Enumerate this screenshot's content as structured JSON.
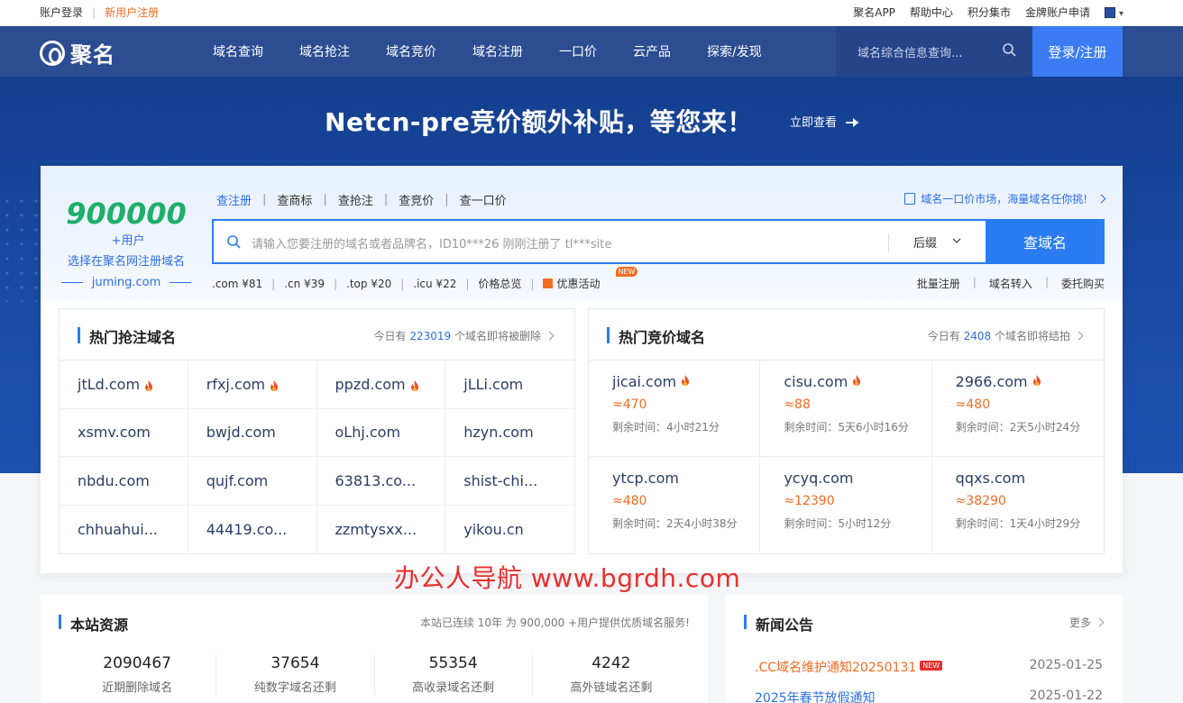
{
  "topbar": {
    "login": "账户登录",
    "register": "新用户注册",
    "links": [
      "聚名APP",
      "帮助中心",
      "积分集市",
      "金牌账户申请"
    ]
  },
  "nav": {
    "logo_text": "聚名",
    "menu": [
      "域名查询",
      "域名抢注",
      "域名竞价",
      "域名注册",
      "一口价",
      "云产品",
      "探索/发现"
    ],
    "search_placeholder": "域名综合信息查询...",
    "login_button": "登录/注册"
  },
  "banner": {
    "headline": "Netcn-pre竞价额外补贴，等您来！",
    "cta": "立即查看"
  },
  "promo": {
    "number": "900000",
    "unit": "+用户",
    "line": "选择在聚名网注册域名",
    "site": "juming.com"
  },
  "query_tabs": [
    "查注册",
    "查商标",
    "查抢注",
    "查竞价",
    "查一口价"
  ],
  "market_link": "域名一口价市场，海量域名任你挑!",
  "search": {
    "placeholder": "请输入您要注册的域名或者品牌名，ID10***26 刚刚注册了 tl***site",
    "suffix": "后缀",
    "button": "查域名"
  },
  "prices": [
    ".com ¥81",
    ".cn ¥39",
    ".top ¥20",
    ".icu ¥22",
    "价格总览",
    "优惠活动"
  ],
  "new_tag": "NEW",
  "right_links": [
    "批量注册",
    "域名转入",
    "委托购买"
  ],
  "hot_snap": {
    "title": "热门抢注域名",
    "note_prefix": "今日有",
    "count": "223019",
    "note_suffix": "个域名即将被删除",
    "domains": [
      {
        "name": "jtLd.com",
        "hot": true
      },
      {
        "name": "rfxj.com",
        "hot": true
      },
      {
        "name": "ppzd.com",
        "hot": true
      },
      {
        "name": "jLLi.com",
        "hot": false
      },
      {
        "name": "xsmv.com",
        "hot": false
      },
      {
        "name": "bwjd.com",
        "hot": false
      },
      {
        "name": "oLhj.com",
        "hot": false
      },
      {
        "name": "hzyn.com",
        "hot": false
      },
      {
        "name": "nbdu.com",
        "hot": false
      },
      {
        "name": "qujf.com",
        "hot": false
      },
      {
        "name": "63813.co...",
        "hot": false
      },
      {
        "name": "shist-chi...",
        "hot": false
      },
      {
        "name": "chhuahui...",
        "hot": false
      },
      {
        "name": "44419.co...",
        "hot": false
      },
      {
        "name": "zzmtysxx...",
        "hot": false
      },
      {
        "name": "yikou.cn",
        "hot": false
      }
    ]
  },
  "hot_auction": {
    "title": "热门竞价域名",
    "note_prefix": "今日有",
    "count": "2408",
    "note_suffix": "个域名即将结拍",
    "items": [
      {
        "name": "jicai.com",
        "hot": true,
        "price": "≈470",
        "time": "剩余时间：4小时21分"
      },
      {
        "name": "cisu.com",
        "hot": true,
        "price": "≈88",
        "time": "剩余时间：5天6小时16分"
      },
      {
        "name": "2966.com",
        "hot": true,
        "price": "≈480",
        "time": "剩余时间：2天5小时24分"
      },
      {
        "name": "ytcp.com",
        "hot": false,
        "price": "≈480",
        "time": "剩余时间：2天4小时38分"
      },
      {
        "name": "ycyq.com",
        "hot": false,
        "price": "≈12390",
        "time": "剩余时间：5小时12分"
      },
      {
        "name": "qqxs.com",
        "hot": false,
        "price": "≈38290",
        "time": "剩余时间：1天4小时29分"
      }
    ]
  },
  "watermark": "办公人导航  www.bgrdh.com",
  "resources": {
    "title": "本站资源",
    "note": "本站已连续 10年 为 900,000 +用户提供优质域名服务!",
    "stats": [
      {
        "value": "2090467",
        "label": "近期删除域名"
      },
      {
        "value": "37654",
        "label": "纯数字域名还剩"
      },
      {
        "value": "55354",
        "label": "高收录域名还剩"
      },
      {
        "value": "4242",
        "label": "高外链域名还剩"
      }
    ]
  },
  "news": {
    "title": "新闻公告",
    "more": "更多",
    "items": [
      {
        "title": ".CC域名维护通知20250131",
        "date": "2025-01-25",
        "new": true
      },
      {
        "title": "2025年春节放假通知",
        "date": "2025-01-22",
        "new": false
      }
    ]
  },
  "colors": {
    "nav": "#2c4d91",
    "accent": "#2b7cf2",
    "orange": "#f36b21",
    "green": "#1fae6b"
  }
}
